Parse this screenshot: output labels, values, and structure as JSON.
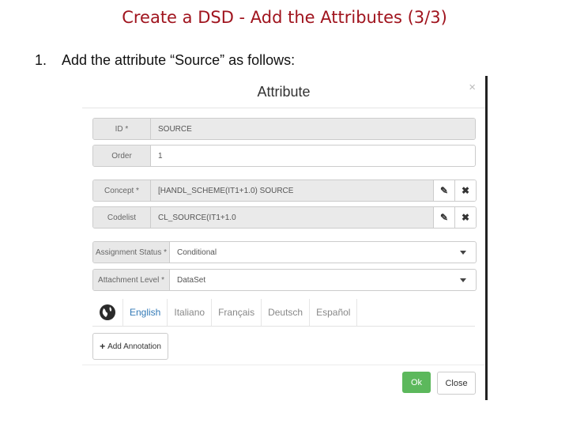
{
  "slide": {
    "title": "Create a DSD - Add the Attributes (3/3)",
    "bullet_number": "1.",
    "bullet_text": "Add the attribute “Source” as follows:"
  },
  "dialog": {
    "title": "Attribute",
    "close_glyph": "×",
    "fields": {
      "id": {
        "label": "ID *",
        "value": "SOURCE"
      },
      "order": {
        "label": "Order",
        "value": "1"
      },
      "concept": {
        "label": "Concept *",
        "value": "[HANDL_SCHEME(IT1+1.0) SOURCE"
      },
      "codelist": {
        "label": "Codelist",
        "value": "CL_SOURCE(IT1+1.0"
      },
      "assignment_status": {
        "label": "Assignment Status *",
        "value": "Conditional"
      },
      "attachment_level": {
        "label": "Attachment Level *",
        "value": "DataSet"
      }
    },
    "edit_icon": "✎",
    "remove_icon": "✖",
    "languages": [
      "English",
      "Italiano",
      "Français",
      "Deutsch",
      "Español"
    ],
    "active_language": "English",
    "add_annotation_label": "Add Annotation",
    "ok_label": "Ok",
    "close_label": "Close"
  },
  "colors": {
    "title_red": "#a0141e",
    "ok_green": "#5cb85c",
    "link_blue": "#337ab7"
  }
}
